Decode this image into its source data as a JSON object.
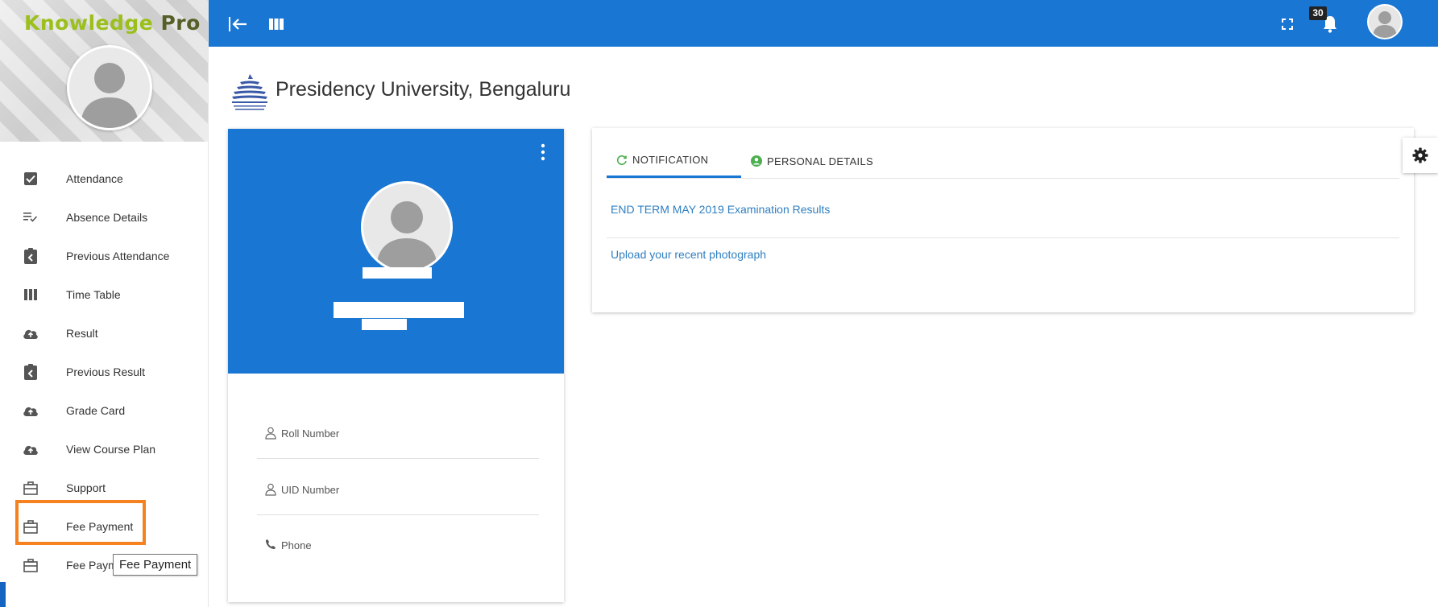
{
  "brand": {
    "part1": "Knowledge",
    "part2": "Pro"
  },
  "sidebar": {
    "items": [
      {
        "label": "Attendance",
        "icon": "checkbox-icon"
      },
      {
        "label": "Absence Details",
        "icon": "list-check-icon"
      },
      {
        "label": "Previous Attendance",
        "icon": "clipboard-back-icon"
      },
      {
        "label": "Time Table",
        "icon": "view-column-icon"
      },
      {
        "label": "Result",
        "icon": "cloud-upload-icon"
      },
      {
        "label": "Previous Result",
        "icon": "clipboard-back-icon"
      },
      {
        "label": "Grade Card",
        "icon": "cloud-upload-icon"
      },
      {
        "label": "View Course Plan",
        "icon": "cloud-upload-icon"
      },
      {
        "label": "Support",
        "icon": "briefcase-icon"
      },
      {
        "label": "Fee Payment",
        "icon": "briefcase-icon"
      },
      {
        "label": "Fee Payment",
        "icon": "briefcase-icon"
      }
    ],
    "tooltip": "Fee Payment"
  },
  "topbar": {
    "notification_count": "30",
    "icons": [
      "back-arrow-icon",
      "view-column-icon",
      "fullscreen-icon",
      "bell-icon",
      "user-avatar"
    ]
  },
  "university": {
    "name": "Presidency University, Bengaluru"
  },
  "profile": {
    "fields": [
      {
        "label": "Roll Number",
        "icon": "person-outline-icon"
      },
      {
        "label": "UID Number",
        "icon": "person-outline-icon"
      },
      {
        "label": "Phone",
        "icon": "phone-icon"
      }
    ]
  },
  "notifications": {
    "tabs": [
      {
        "label": "NOTIFICATION",
        "active": true
      },
      {
        "label": "PERSONAL DETAILS",
        "active": false
      }
    ],
    "items": [
      "END TERM MAY 2019 Examination Results",
      "Upload your recent photograph"
    ]
  },
  "colors": {
    "primary": "#1976d2",
    "brand_green": "#9bbf1b",
    "brand_olive": "#555f27",
    "highlight": "#f5821f",
    "link": "#2f7fc1",
    "tab_icon_green": "#4caf50"
  }
}
